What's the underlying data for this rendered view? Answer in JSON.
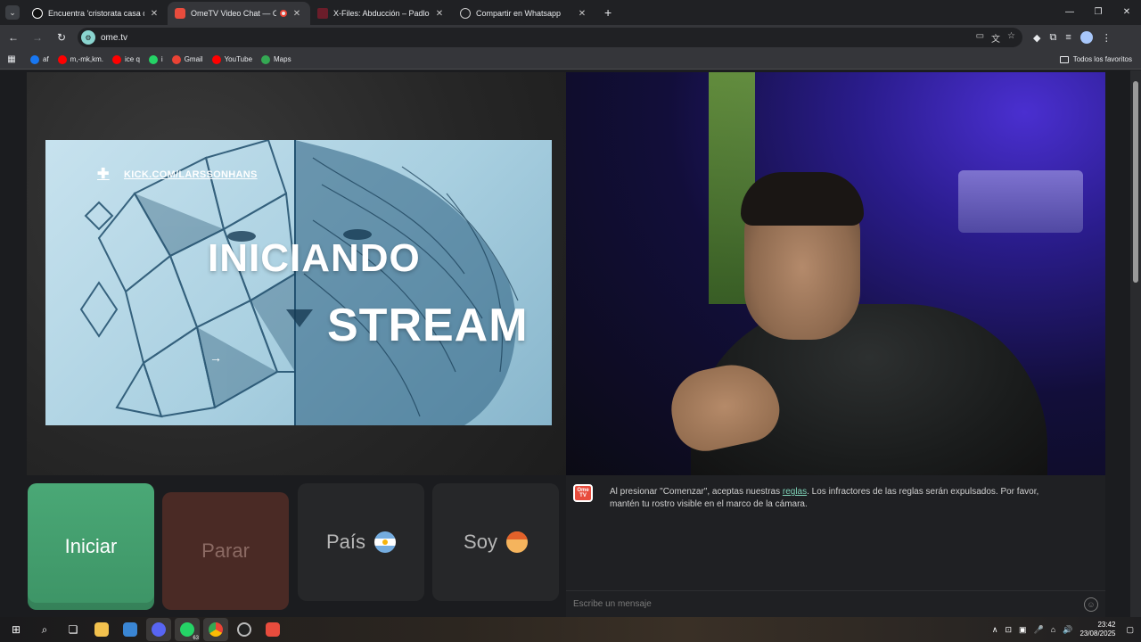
{
  "tabs": [
    {
      "title": "Encuentra 'cristorata casa del te",
      "active": false,
      "favicon": "tiktok-icon"
    },
    {
      "title": "OmeTV Video Chat — Ome",
      "active": true,
      "favicon": "ometv-icon",
      "recording": true
    },
    {
      "title": "X-Files: Abducción – Padlock En",
      "active": false,
      "favicon": "padlock-icon"
    },
    {
      "title": "Compartir en Whatsapp",
      "active": false,
      "favicon": "globe-icon"
    }
  ],
  "address": {
    "url": "ome.tv"
  },
  "bookmarks": [
    {
      "label": "af",
      "icon": "facebook-icon",
      "color": "#1877f2"
    },
    {
      "label": "m,-mk,km.",
      "icon": "youtube-icon",
      "color": "#ff0000"
    },
    {
      "label": "ice q",
      "icon": "youtube-icon",
      "color": "#ff0000"
    },
    {
      "label": "i",
      "icon": "whatsapp-icon",
      "color": "#25d366"
    },
    {
      "label": "Gmail",
      "icon": "gmail-icon",
      "color": "#ea4335"
    },
    {
      "label": "YouTube",
      "icon": "youtube-icon",
      "color": "#ff0000"
    },
    {
      "label": "Maps",
      "icon": "maps-icon",
      "color": "#34a853"
    }
  ],
  "bookmarks_all": "Todos los favoritos",
  "stream": {
    "kick_link": "KICK.COM/LARSSONHANS",
    "line1": "INICIANDO",
    "line2": "STREAM"
  },
  "controls": {
    "start": "Iniciar",
    "stop": "Parar",
    "country": "País",
    "me": "Soy"
  },
  "chat": {
    "msg_before": "Al presionar \"Comenzar\", aceptas nuestras ",
    "msg_link": "reglas",
    "msg_after": ". Los infractores de las reglas serán expulsados. Por favor, mantén tu rostro visible en el marco de la cámara.",
    "input_placeholder": "Escribe un mensaje",
    "logo_text": "Ome TV"
  },
  "taskbar": {
    "time": "23:42",
    "date": "23/08/2025",
    "whatsapp_badge": "63"
  },
  "colors": {
    "start_button": "#45a06f",
    "stop_button": "#4a2a25",
    "link": "#7fd3b8",
    "ome_red": "#e84c3d"
  }
}
